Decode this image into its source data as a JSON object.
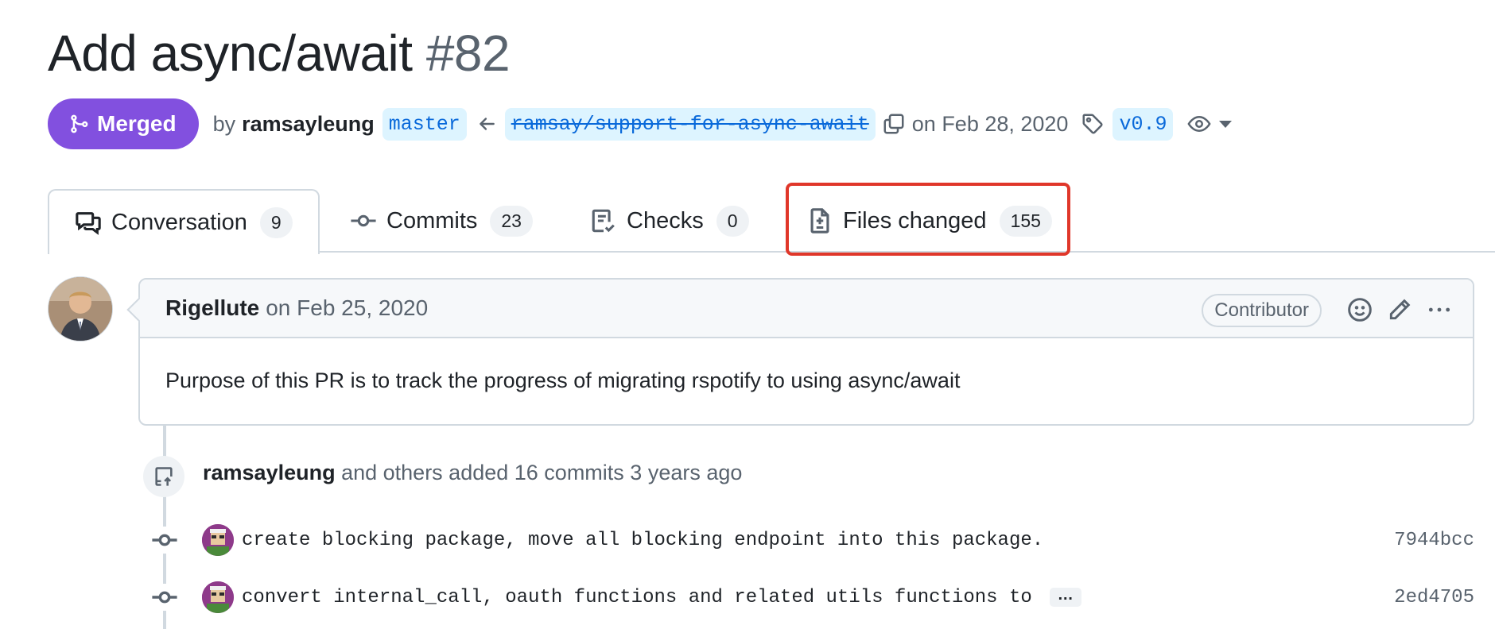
{
  "pr": {
    "title": "Add async/await",
    "number": "#82",
    "status": "Merged",
    "by_label": "by",
    "author": "ramsayleung",
    "base_branch": "master",
    "head_branch": "ramsay/support-for-async-await",
    "date_text": "on Feb 28, 2020",
    "tag": "v0.9"
  },
  "tabs": [
    {
      "label": "Conversation",
      "count": "9",
      "icon": "comment-discussion-icon",
      "active": true
    },
    {
      "label": "Commits",
      "count": "23",
      "icon": "commit-icon"
    },
    {
      "label": "Checks",
      "count": "0",
      "icon": "checklist-icon"
    },
    {
      "label": "Files changed",
      "count": "155",
      "icon": "file-diff-icon",
      "highlighted": true
    }
  ],
  "comment": {
    "author": "Rigellute",
    "date_text": "on Feb 25, 2020",
    "role": "Contributor",
    "body": "Purpose of this PR is to track the progress of migrating rspotify to using async/await"
  },
  "timeline_event": {
    "author": "ramsayleung",
    "text": "and others added 16 commits 3 years ago"
  },
  "commits": [
    {
      "message": "create blocking package, move all blocking endpoint into this package.",
      "sha": "7944bcc",
      "truncated": false
    },
    {
      "message": "convert internal_call, oauth functions and related utils functions to",
      "sha": "2ed4705",
      "truncated": true,
      "ellipsis": "…"
    }
  ],
  "colors": {
    "merged": "#8250df",
    "link": "#0969da",
    "branch_bg": "#ddf4ff",
    "highlight": "#e0372a",
    "muted": "#59636e",
    "border": "#d1d9e0"
  }
}
